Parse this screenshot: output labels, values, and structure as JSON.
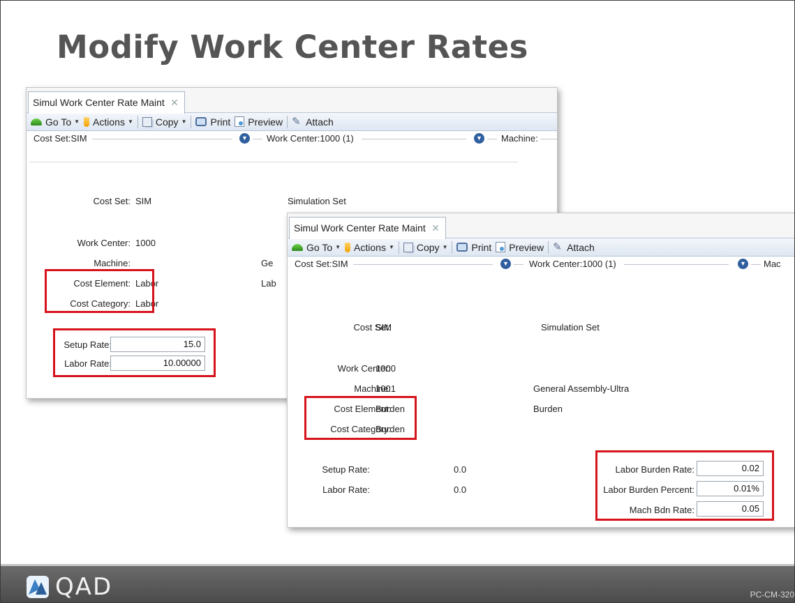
{
  "slide": {
    "title": "Modify Work Center Rates",
    "logo_text": "QAD",
    "code": "PC-CM-320"
  },
  "toolbar": {
    "goto": "Go To",
    "actions": "Actions",
    "copy": "Copy",
    "print": "Print",
    "preview": "Preview",
    "attach": "Attach"
  },
  "window1": {
    "tab_title": "Simul Work Center Rate Maint",
    "header": {
      "cost_set": "Cost Set:SIM",
      "work_center": "Work Center:1000 (1)",
      "machine": "Machine:"
    },
    "cost_set_label": "Cost Set:",
    "cost_set_value": "SIM",
    "cost_set_desc": "Simulation Set",
    "work_center_label": "Work Center:",
    "work_center_value": "1000",
    "machine_label": "Machine:",
    "cost_element_label": "Cost Element:",
    "cost_element_value": "Labor",
    "cost_category_label": "Cost Category:",
    "cost_category_value": "Labor",
    "setup_rate_label": "Setup Rate:",
    "setup_rate_value": "15.0",
    "labor_rate_label": "Labor Rate:",
    "labor_rate_value": "10.00000",
    "partial_ge": "Ge",
    "partial_lab": "Lab"
  },
  "window2": {
    "tab_title": "Simul Work Center Rate Maint",
    "header": {
      "cost_set": "Cost Set:SIM",
      "work_center": "Work Center:1000 (1)",
      "machine": "Mac"
    },
    "cost_set_label": "Cost Set:",
    "cost_set_value": "SIM",
    "cost_set_desc": "Simulation Set",
    "work_center_label": "Work Center:",
    "work_center_value": "1000",
    "machine_label": "Machine:",
    "machine_value": "1001",
    "machine_desc": "General Assembly-Ultra",
    "cost_element_label": "Cost Element:",
    "cost_element_value": "Burden",
    "cost_element_desc": "Burden",
    "cost_category_label": "Cost Category:",
    "cost_category_value": "Burden",
    "setup_rate_label": "Setup Rate:",
    "setup_rate_value": "0.0",
    "labor_rate_label": "Labor Rate:",
    "labor_rate_value": "0.0",
    "labor_burden_rate_label": "Labor Burden Rate:",
    "labor_burden_rate_value": "0.02",
    "labor_burden_percent_label": "Labor Burden Percent:",
    "labor_burden_percent_value": "0.01%",
    "mach_bdn_rate_label": "Mach Bdn Rate:",
    "mach_bdn_rate_value": "0.05"
  },
  "colors": {
    "highlight": "#d6121a",
    "footer": "#555555",
    "title": "#555555"
  }
}
